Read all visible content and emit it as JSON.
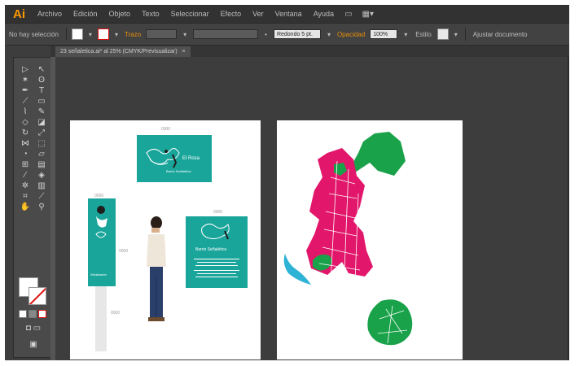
{
  "app": {
    "logo": "Ai",
    "accent": "#ff9a00"
  },
  "menu": {
    "items": [
      "Archivo",
      "Edición",
      "Objeto",
      "Texto",
      "Seleccionar",
      "Efecto",
      "Ver",
      "Ventana",
      "Ayuda"
    ]
  },
  "control_bar": {
    "selection_status": "No hay selección",
    "stroke_label": "Trazo",
    "stroke_value": "",
    "brush_label": "Redondo 5 pt.",
    "opacity_label": "Opacidad",
    "opacity_value": "100%",
    "style_label": "Estilo",
    "doc_setup_button": "Ajustar documento"
  },
  "document_tab": {
    "title": "23 señaletica.ai* al 25% (CMYK/Previsualizar)",
    "close": "×"
  },
  "artboard1": {
    "dim_top": "0000",
    "dim_left": "0000",
    "dim_right": "0000",
    "dim_mid": "0000",
    "dim_bottom": "0000",
    "sign_top_title": "El Rosa",
    "sign_top_subtitle": "Barrio Señalética",
    "sign_right_title": "Barrio Señalética",
    "totem_label": "Señalización"
  },
  "colors": {
    "canvas": "#3d3d3d",
    "teal": "#1aa59b",
    "pink": "#e2166a",
    "green": "#1aa24a",
    "blue": "#2eb3d6"
  }
}
